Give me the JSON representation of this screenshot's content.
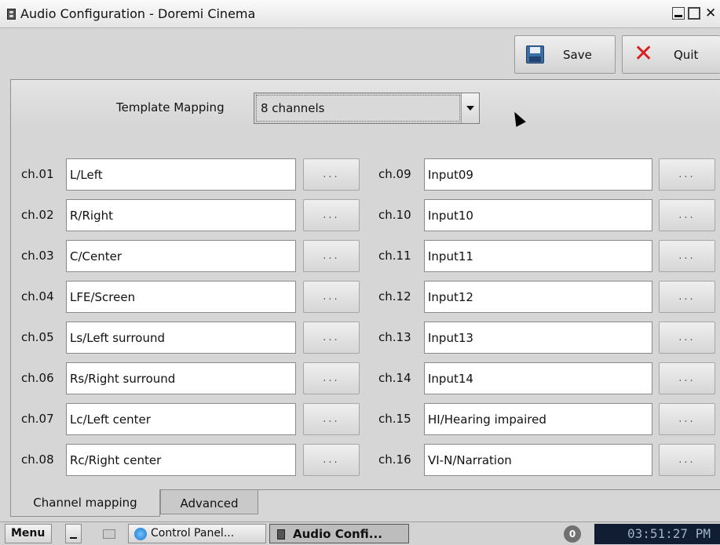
{
  "window": {
    "title": "Audio Configuration - Doremi Cinema",
    "close_glyph": "✕"
  },
  "toolbar": {
    "save_label": "Save",
    "quit_label": "Quit"
  },
  "template": {
    "label": "Template Mapping",
    "value": "8 channels"
  },
  "channels_left": [
    {
      "label": "ch.01",
      "value": "L/Left"
    },
    {
      "label": "ch.02",
      "value": "R/Right"
    },
    {
      "label": "ch.03",
      "value": "C/Center"
    },
    {
      "label": "ch.04",
      "value": "LFE/Screen"
    },
    {
      "label": "ch.05",
      "value": "Ls/Left surround"
    },
    {
      "label": "ch.06",
      "value": "Rs/Right surround"
    },
    {
      "label": "ch.07",
      "value": "Lc/Left center"
    },
    {
      "label": "ch.08",
      "value": "Rc/Right center"
    }
  ],
  "channels_right": [
    {
      "label": "ch.09",
      "value": "Input09"
    },
    {
      "label": "ch.10",
      "value": "Input10"
    },
    {
      "label": "ch.11",
      "value": "Input11"
    },
    {
      "label": "ch.12",
      "value": "Input12"
    },
    {
      "label": "ch.13",
      "value": "Input13"
    },
    {
      "label": "ch.14",
      "value": "Input14"
    },
    {
      "label": "ch.15",
      "value": "HI/Hearing impaired"
    },
    {
      "label": "ch.16",
      "value": "VI-N/Narration"
    }
  ],
  "browse_label": "...",
  "tabs": [
    {
      "label": "Channel mapping"
    },
    {
      "label": "Advanced"
    }
  ],
  "taskbar": {
    "menu_label": "Menu",
    "items": [
      {
        "label": "Control Panel..."
      },
      {
        "label": "Audio Confi..."
      }
    ],
    "badge": "0",
    "clock": "03:51:27 PM"
  }
}
